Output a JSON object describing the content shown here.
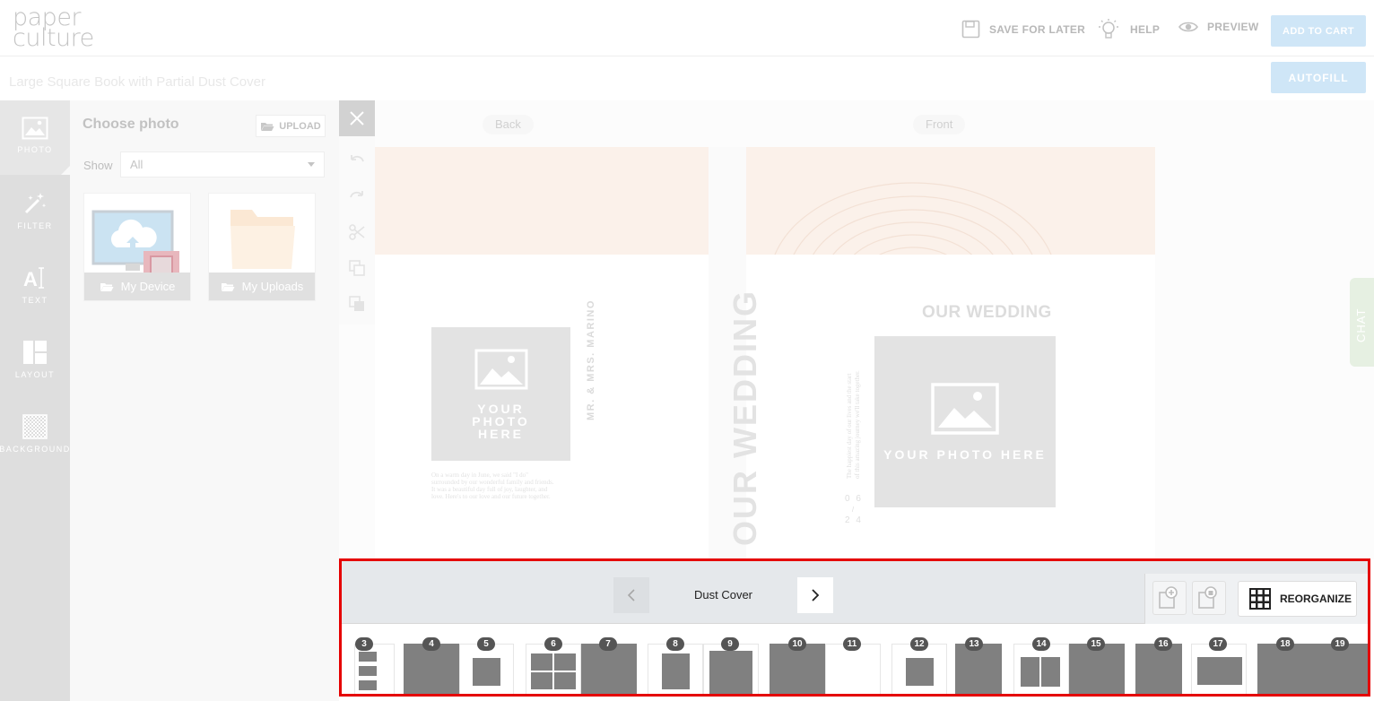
{
  "header": {
    "logo_line1": "paper",
    "logo_line2": "culture",
    "save_label": "SAVE FOR LATER",
    "help_label": "HELP",
    "preview_label": "PREVIEW",
    "cart_label": "ADD TO CART"
  },
  "subheader": {
    "product_title": "Large Square Book with Partial Dust Cover",
    "autofill_label": "AUTOFILL"
  },
  "sidebar": {
    "items": [
      {
        "label": "PHOTO",
        "icon": "photo-icon"
      },
      {
        "label": "FILTER",
        "icon": "magic-wand-icon"
      },
      {
        "label": "TEXT",
        "icon": "text-icon"
      },
      {
        "label": "LAYOUT",
        "icon": "layout-icon"
      },
      {
        "label": "BACKGROUND",
        "icon": "background-icon"
      }
    ]
  },
  "photo_panel": {
    "title": "Choose photo",
    "upload_label": "UPLOAD",
    "show_label": "Show",
    "show_value": "All",
    "sources": [
      {
        "label": "My Device"
      },
      {
        "label": "My Uploads"
      }
    ]
  },
  "canvas": {
    "back_label": "Back",
    "front_label": "Front",
    "back_cover": {
      "photo_placeholder": "YOUR PHOTO HERE",
      "names": "MR. & MRS. MARINO",
      "story_lines": [
        "On a warm day in June, we said \"I do\"",
        "surrounded by our wonderful family and friends.",
        "It was a beautiful day full of joy, laughter, and",
        "love. Here's to our love and our future together."
      ]
    },
    "spine_title": "OUR WEDDING",
    "front_cover": {
      "title": "OUR WEDDING",
      "photo_placeholder": "YOUR PHOTO HERE",
      "tagline_1": "The happiest day of our lives and the start",
      "tagline_2": "of this amazing journey we'll take together.",
      "date_1": "0 6",
      "date_2": "2 4"
    }
  },
  "chat_label": "CHAT",
  "page_nav": {
    "current_page": "Dust Cover",
    "reorganize_label": "REORGANIZE"
  },
  "thumbnails": {
    "badges": [
      "3",
      "4",
      "5",
      "6",
      "7",
      "8",
      "9",
      "10",
      "11",
      "12",
      "13",
      "14",
      "15",
      "16",
      "17",
      "18",
      "19"
    ]
  }
}
